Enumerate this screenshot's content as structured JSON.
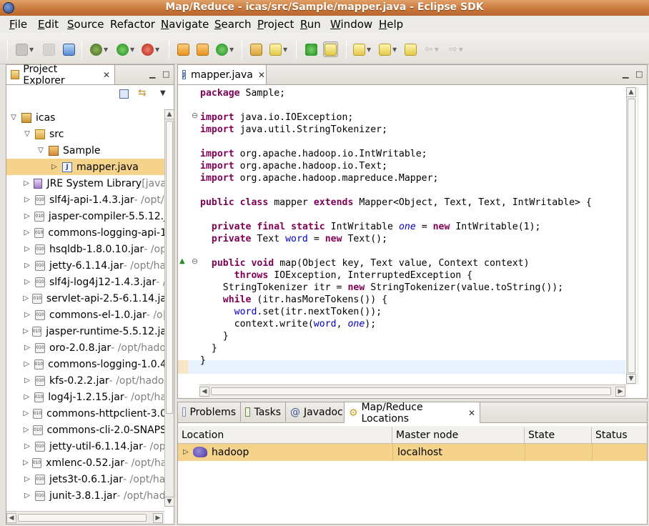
{
  "window": {
    "title": "Map/Reduce - icas/src/Sample/mapper.java - Eclipse SDK"
  },
  "menubar": [
    {
      "label": "File",
      "mnemonic": "F",
      "rest": "ile"
    },
    {
      "label": "Edit",
      "mnemonic": "E",
      "rest": "dit"
    },
    {
      "label": "Source",
      "mnemonic": "S",
      "rest": "ource"
    },
    {
      "label": "Refactor",
      "mnemonic": "",
      "rest": "Refactor"
    },
    {
      "label": "Navigate",
      "mnemonic": "N",
      "rest": "avigate"
    },
    {
      "label": "Search",
      "mnemonic": "S",
      "rest": "earch"
    },
    {
      "label": "Project",
      "mnemonic": "P",
      "rest": "roject"
    },
    {
      "label": "Run",
      "mnemonic": "R",
      "rest": "un"
    },
    {
      "label": "Window",
      "mnemonic": "W",
      "rest": "indow"
    },
    {
      "label": "Help",
      "mnemonic": "H",
      "rest": "elp"
    }
  ],
  "explorer": {
    "title": "Project Explorer",
    "tree": [
      {
        "name": "icas",
        "detail": ""
      },
      {
        "name": "src",
        "detail": ""
      },
      {
        "name": "Sample",
        "detail": ""
      },
      {
        "name": "mapper.java",
        "detail": ""
      },
      {
        "name": "JRE System Library",
        "detail": " [java"
      },
      {
        "name": "slf4j-api-1.4.3.jar",
        "detail": " - /opt/"
      },
      {
        "name": "jasper-compiler-5.5.12.j",
        "detail": ""
      },
      {
        "name": "commons-logging-api-1",
        "detail": ""
      },
      {
        "name": "hsqldb-1.8.0.10.jar",
        "detail": " - /op"
      },
      {
        "name": "jetty-6.1.14.jar",
        "detail": " - /opt/ha"
      },
      {
        "name": "slf4j-log4j12-1.4.3.jar",
        "detail": " - /"
      },
      {
        "name": "servlet-api-2.5-6.1.14.ja",
        "detail": ""
      },
      {
        "name": "commons-el-1.0.jar",
        "detail": " - /o|"
      },
      {
        "name": "jasper-runtime-5.5.12.ja",
        "detail": ""
      },
      {
        "name": "oro-2.0.8.jar",
        "detail": " - /opt/hado"
      },
      {
        "name": "commons-logging-1.0.4",
        "detail": ""
      },
      {
        "name": "kfs-0.2.2.jar",
        "detail": " - /opt/hado"
      },
      {
        "name": "log4j-1.2.15.jar",
        "detail": " - /opt/ha"
      },
      {
        "name": "commons-httpclient-3.0",
        "detail": ""
      },
      {
        "name": "commons-cli-2.0-SNAPS",
        "detail": ""
      },
      {
        "name": "jetty-util-6.1.14.jar",
        "detail": " - /op"
      },
      {
        "name": "xmlenc-0.52.jar",
        "detail": " - /opt/ha"
      },
      {
        "name": "jets3t-0.6.1.jar",
        "detail": " - /opt/ha"
      },
      {
        "name": "junit-3.8.1.jar",
        "detail": " - /opt/had"
      }
    ]
  },
  "editor": {
    "tab": "mapper.java",
    "code": [
      [
        {
          "t": "kw",
          "s": "package"
        },
        {
          "t": "",
          "s": " Sample;"
        }
      ],
      [],
      [
        {
          "t": "kw",
          "s": "import"
        },
        {
          "t": "",
          "s": " java.io.IOException;"
        }
      ],
      [
        {
          "t": "kw",
          "s": "import"
        },
        {
          "t": "",
          "s": " java.util.StringTokenizer;"
        }
      ],
      [],
      [
        {
          "t": "kw",
          "s": "import"
        },
        {
          "t": "",
          "s": " org.apache.hadoop.io.IntWritable;"
        }
      ],
      [
        {
          "t": "kw",
          "s": "import"
        },
        {
          "t": "",
          "s": " org.apache.hadoop.io.Text;"
        }
      ],
      [
        {
          "t": "kw",
          "s": "import"
        },
        {
          "t": "",
          "s": " org.apache.hadoop.mapreduce.Mapper;"
        }
      ],
      [],
      [
        {
          "t": "kw",
          "s": "public"
        },
        {
          "t": "",
          "s": " "
        },
        {
          "t": "kw",
          "s": "class"
        },
        {
          "t": "",
          "s": " mapper "
        },
        {
          "t": "kw",
          "s": "extends"
        },
        {
          "t": "",
          "s": " Mapper<Object, Text, Text, IntWritable> {"
        }
      ],
      [],
      [
        {
          "t": "",
          "s": "  "
        },
        {
          "t": "kw",
          "s": "private"
        },
        {
          "t": "",
          "s": " "
        },
        {
          "t": "kw",
          "s": "final"
        },
        {
          "t": "",
          "s": " "
        },
        {
          "t": "kw",
          "s": "static"
        },
        {
          "t": "",
          "s": " IntWritable "
        },
        {
          "t": "sfld",
          "s": "one"
        },
        {
          "t": "",
          "s": " = "
        },
        {
          "t": "kw",
          "s": "new"
        },
        {
          "t": "",
          "s": " IntWritable(1);"
        }
      ],
      [
        {
          "t": "",
          "s": "  "
        },
        {
          "t": "kw",
          "s": "private"
        },
        {
          "t": "",
          "s": " Text "
        },
        {
          "t": "fld",
          "s": "word"
        },
        {
          "t": "",
          "s": " = "
        },
        {
          "t": "kw",
          "s": "new"
        },
        {
          "t": "",
          "s": " Text();"
        }
      ],
      [],
      [
        {
          "t": "",
          "s": "  "
        },
        {
          "t": "kw",
          "s": "public"
        },
        {
          "t": "",
          "s": " "
        },
        {
          "t": "kw",
          "s": "void"
        },
        {
          "t": "",
          "s": " map(Object key, Text value, Context context)"
        }
      ],
      [
        {
          "t": "",
          "s": "      "
        },
        {
          "t": "kw",
          "s": "throws"
        },
        {
          "t": "",
          "s": " IOException, InterruptedException {"
        }
      ],
      [
        {
          "t": "",
          "s": "    StringTokenizer itr = "
        },
        {
          "t": "kw",
          "s": "new"
        },
        {
          "t": "",
          "s": " StringTokenizer(value.toString());"
        }
      ],
      [
        {
          "t": "",
          "s": "    "
        },
        {
          "t": "kw",
          "s": "while"
        },
        {
          "t": "",
          "s": " (itr.hasMoreTokens()) {"
        }
      ],
      [
        {
          "t": "",
          "s": "      "
        },
        {
          "t": "fld",
          "s": "word"
        },
        {
          "t": "",
          "s": ".set(itr.nextToken());"
        }
      ],
      [
        {
          "t": "",
          "s": "      context.write("
        },
        {
          "t": "fld",
          "s": "word"
        },
        {
          "t": "",
          "s": ", "
        },
        {
          "t": "sfld",
          "s": "one"
        },
        {
          "t": "",
          "s": ");"
        }
      ],
      [
        {
          "t": "",
          "s": "    }"
        }
      ],
      [
        {
          "t": "",
          "s": "  }"
        }
      ],
      [
        {
          "t": "",
          "s": "}"
        }
      ]
    ]
  },
  "bottom": {
    "tabs": [
      "Problems",
      "Tasks",
      "Javadoc",
      "Map/Reduce Locations"
    ],
    "columns": [
      "Location",
      "Master node",
      "State",
      "Status"
    ],
    "rows": [
      {
        "location": "hadoop",
        "master": "localhost",
        "state": "",
        "status": ""
      }
    ]
  }
}
